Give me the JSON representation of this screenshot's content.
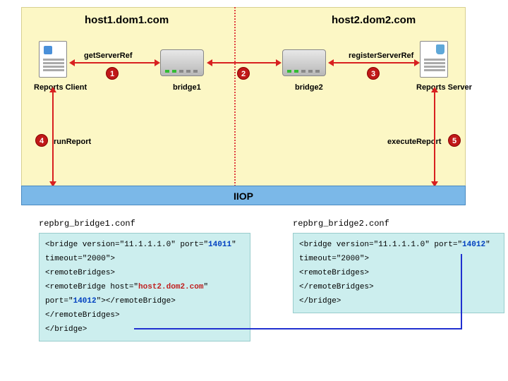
{
  "hosts": {
    "h1": "host1.dom1.com",
    "h2": "host2.dom2.com"
  },
  "nodes": {
    "client": "Reports Client",
    "server": "Reports Server",
    "b1": "bridge1",
    "b2": "bridge2"
  },
  "actions": {
    "get": "getServerRef",
    "reg": "registerServerRef",
    "run": "runReport",
    "exec": "executeReport"
  },
  "badges": {
    "b1": "1",
    "b2": "2",
    "b3": "3",
    "b4": "4",
    "b5": "5"
  },
  "iiop": "IIOP",
  "conf1": {
    "title": "repbrg_bridge1.conf",
    "l1a": "<bridge version=\"",
    "ver": "11.1.1.1.0",
    "l1b": "\" port=\"",
    "port": "14011",
    "l1c": "\"",
    "l2": "timeout=\"2000\">",
    "l3": "  <remoteBridges>",
    "l4a": "    <remoteBridge host=\"",
    "host": "host2.dom2.com",
    "l4b": "\"",
    "l5a": "port=\"",
    "rport": "14012",
    "l5b": "\"></remoteBridge>",
    "l6": "  </remoteBridges>",
    "l7": "</bridge>"
  },
  "conf2": {
    "title": "repbrg_bridge2.conf",
    "l1a": "<bridge version=\"",
    "ver": "11.1.1.1.0",
    "l1b": "\" port=\"",
    "port": "14012",
    "l1c": "\"",
    "l2": "timeout=\"2000\">",
    "l3": "  <remoteBridges>",
    "l4": "  </remoteBridges>",
    "l5": "</bridge>"
  }
}
